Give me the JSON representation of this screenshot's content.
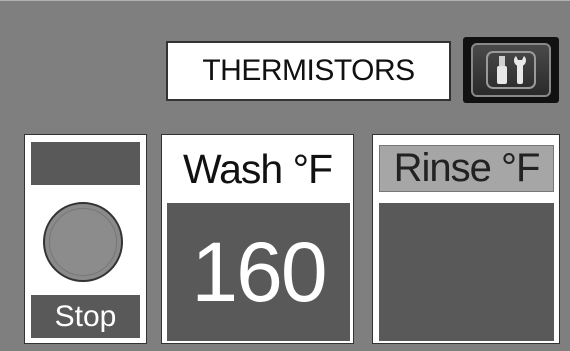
{
  "header": {
    "title": "THERMISTORS",
    "tools_button_icon": "wrench-screwdriver-icon"
  },
  "stop_panel": {
    "label": "Stop"
  },
  "wash_panel": {
    "title": "Wash °F",
    "value": "160"
  },
  "rinse_panel": {
    "title": "Rinse °F",
    "value": ""
  },
  "colors": {
    "background": "#7f7f7f",
    "panel_dark": "#595959",
    "panel_light": "#a6a6a6"
  }
}
